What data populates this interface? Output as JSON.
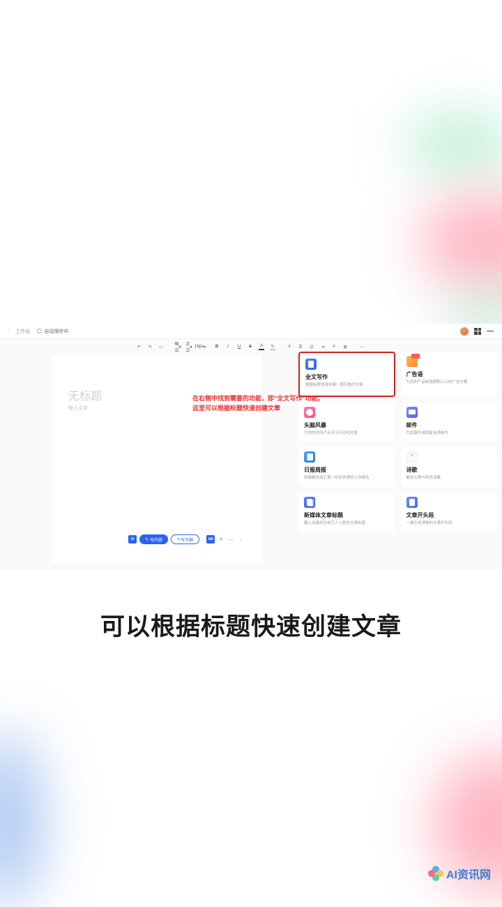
{
  "topbar": {
    "back": "‹",
    "crumb": "工作台",
    "autosave": "自动保存中"
  },
  "toolbar": {
    "undo": "↶",
    "redo": "↷",
    "format": "格式",
    "formal": "正式",
    "size": "16px",
    "bold": "B",
    "italic": "I",
    "underline": "U",
    "strike": "S",
    "textcolor": "A",
    "highlight": "✎"
  },
  "document": {
    "title_placeholder": "无标题",
    "body_placeholder": "输入文字"
  },
  "action_bar": {
    "ai": "AI",
    "btn1": "写内容",
    "btn2": "写大纲",
    "ab": "AB"
  },
  "annotation": {
    "line1": "在右侧中找到需要的功能，即\"全文写作\"功能。",
    "line2": "这里可以根据标题快速创建文章"
  },
  "cards": [
    {
      "title": "全文写作",
      "desc": "根据标题快速创建一篇完整的文章",
      "icon": "icon-fullwrite",
      "highlight": true
    },
    {
      "title": "广告语",
      "desc": "为您的产品制造朗朗上口的广告文案",
      "icon": "icon-ad"
    },
    {
      "title": "头脑风暴",
      "desc": "为您的创作产出天马行空的灵感",
      "icon": "icon-brain"
    },
    {
      "title": "邮件",
      "desc": "为您撰写或回复各类邮件",
      "icon": "icon-mail"
    },
    {
      "title": "日报周报",
      "desc": "将模糊总结汇报一份有条理的工作报告",
      "icon": "icon-report"
    },
    {
      "title": "诗歌",
      "desc": "触发主题与特色诗歌",
      "icon": "icon-poem"
    },
    {
      "title": "新媒体文章标题",
      "desc": "输入关键词生成引人入胜的文章标题",
      "icon": "icon-media"
    },
    {
      "title": "文章开头段",
      "desc": "一键生成清晰的文章开头段",
      "icon": "icon-intro"
    }
  ],
  "caption": "可以根据标题快速创建文章",
  "watermark": "AI资讯网"
}
